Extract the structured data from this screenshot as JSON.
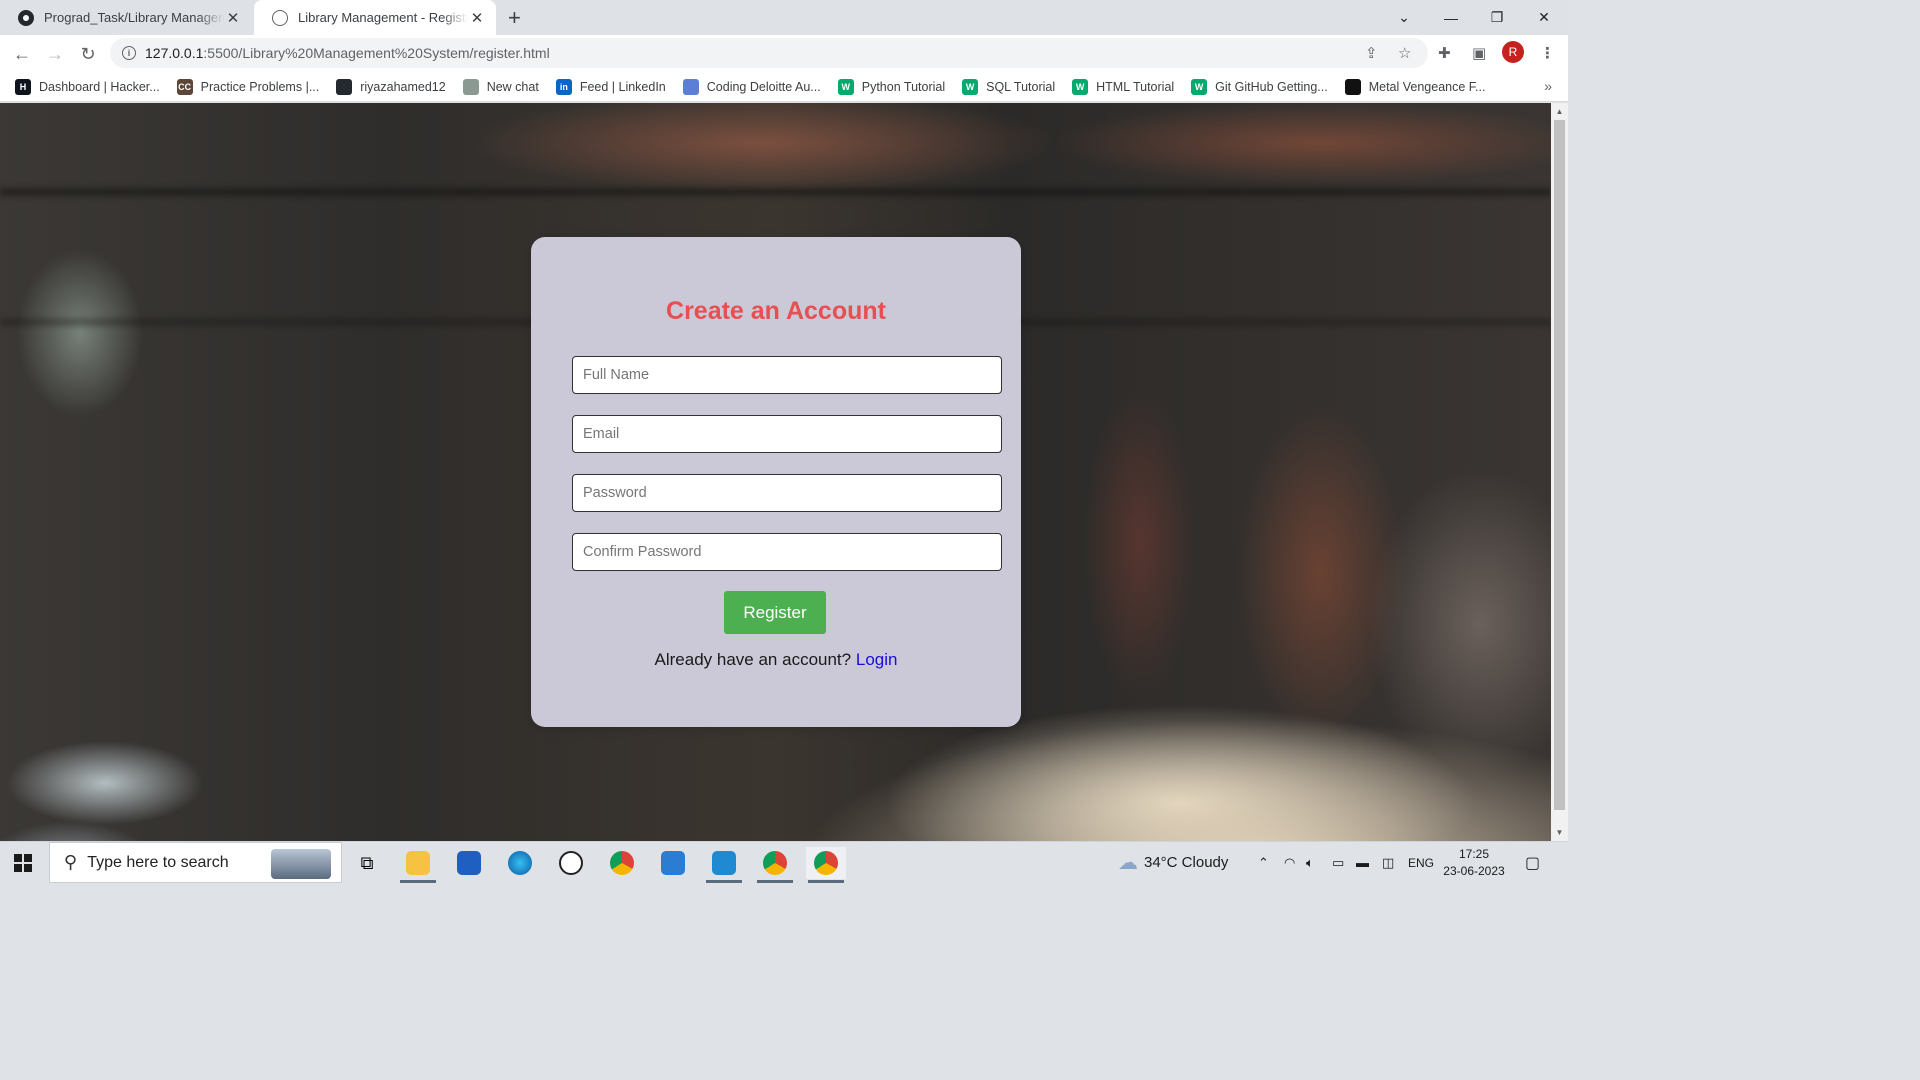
{
  "browser": {
    "tabs": [
      {
        "title": "Prograd_Task/Library Manageme",
        "icon": "github-icon"
      },
      {
        "title": "Library Management - Registratic",
        "icon": "globe-icon"
      }
    ],
    "new_tab": "+",
    "url_host": "127.0.0.1",
    "url_path": ":5500/Library%20Management%20System/register.html",
    "profile_initial": "R",
    "bookmarks": [
      {
        "label": "Dashboard | Hacker...",
        "icon": "hackerrank-icon",
        "icon_text": "H",
        "color": "#0e141e"
      },
      {
        "label": "Practice Problems |...",
        "icon": "codechef-icon",
        "icon_text": "CC",
        "color": "#5b4638"
      },
      {
        "label": "riyazahamed12",
        "icon": "github-icon",
        "icon_text": "",
        "color": "#24292f"
      },
      {
        "label": "New chat",
        "icon": "chatgpt-icon",
        "icon_text": "",
        "color": "#8a9a92"
      },
      {
        "label": "Feed | LinkedIn",
        "icon": "linkedin-icon",
        "icon_text": "in",
        "color": "#0a66c2"
      },
      {
        "label": "Coding Deloitte Au...",
        "icon": "gem-icon",
        "icon_text": "",
        "color": "#5b7fd6"
      },
      {
        "label": "Python Tutorial",
        "icon": "w3schools-icon",
        "icon_text": "W",
        "color": "#04aa6d"
      },
      {
        "label": "SQL Tutorial",
        "icon": "w3schools-icon",
        "icon_text": "W",
        "color": "#04aa6d"
      },
      {
        "label": "HTML Tutorial",
        "icon": "w3schools-icon",
        "icon_text": "W",
        "color": "#04aa6d"
      },
      {
        "label": "Git GitHub Getting...",
        "icon": "w3schools-icon",
        "icon_text": "W",
        "color": "#04aa6d"
      },
      {
        "label": "Metal Vengeance F...",
        "icon": "vengeance-icon",
        "icon_text": "",
        "color": "#111111"
      }
    ],
    "bookmarks_more": "»"
  },
  "form": {
    "title": "Create an Account",
    "full_name_placeholder": "Full Name",
    "email_placeholder": "Email",
    "password_placeholder": "Password",
    "confirm_placeholder": "Confirm Password",
    "register_label": "Register",
    "login_prompt": "Already have an account?",
    "login_link": "Login",
    "title_color": "#e65050",
    "button_color": "#4caf50"
  },
  "taskbar": {
    "search_text": "Type here to search",
    "weather": "34°C  Cloudy",
    "language": "ENG",
    "time": "17:25",
    "date": "23-06-2023"
  }
}
